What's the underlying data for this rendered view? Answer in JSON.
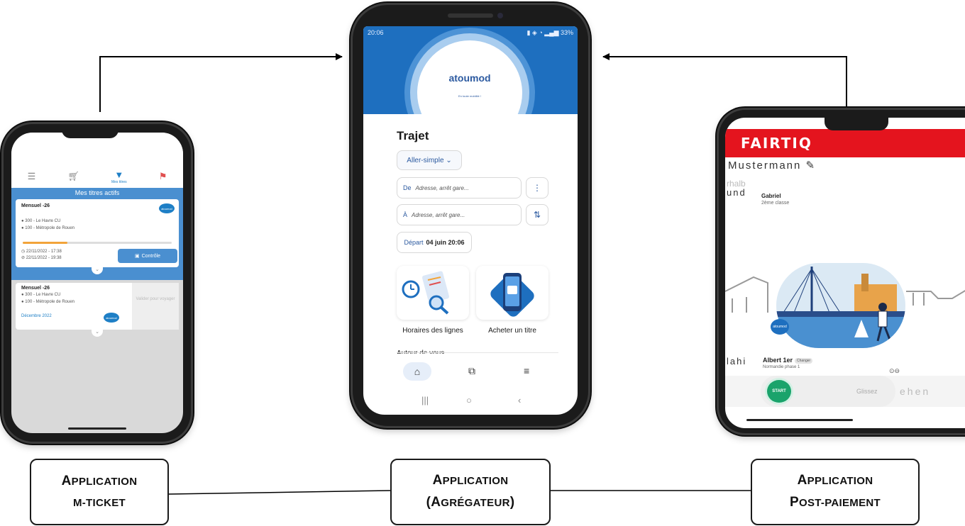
{
  "labels": {
    "mticket": {
      "line1_cap": "A",
      "line1_rest": "PPLICATION",
      "line2": "M-TICKET"
    },
    "aggregator": {
      "line1_cap": "A",
      "line1_rest": "PPLICATION",
      "line2_open": "(A",
      "line2_rest": "GRÉGATEUR",
      "line2_close": ")"
    },
    "postpaid": {
      "line1_cap": "A",
      "line1_rest": "PPLICATION",
      "line2_cap1": "P",
      "line2_rest1": "OST",
      "line2_dash": "-",
      "line2_rest2": "PAIEMENT"
    }
  },
  "left_phone": {
    "nav_active": "Mes titres",
    "band_title": "Mes titres actifs",
    "card1": {
      "title": "Mensuel -26",
      "line_a": "300 - Le Havre CU",
      "line_b": "100 - Métropole de Rouen",
      "progress": 0.3,
      "date_start": "22/11/2022 - 17:38",
      "date_end": "22/11/2022 - 19:38",
      "control_label": "Contrôle"
    },
    "card2": {
      "title": "Mensuel -26",
      "line_a": "300 - Le Havre CU",
      "line_b": "100 - Métropole de Rouen",
      "period": "Décembre 2022",
      "validate_label": "Valider pour voyager"
    }
  },
  "center_phone": {
    "status_time": "20:06",
    "status_right": "33%",
    "logo_text": "atoumod",
    "logo_sub": "En toute mobilité !",
    "title": "Trajet",
    "trip_type": "Aller-simple",
    "from_label": "De",
    "from_placeholder": "Adresse, arrêt gare...",
    "to_label": "À",
    "to_placeholder": "Adresse, arrêt gare...",
    "depart_label": "Départ",
    "depart_value": "04 juin 20:06",
    "tile1_label": "Horaires des lignes",
    "tile2_label": "Acheter un titre",
    "section_peek": "Autour de vous"
  },
  "right_phone": {
    "brand": "FAIRTIQ",
    "user_name": "Mustermann",
    "ghost_top": "rhalb",
    "ghost_left": "und",
    "passenger": "Gabriel",
    "travel_class": "2ème classe",
    "ghost_left2": "lahi",
    "stop": "Albert 1er",
    "change_label": "Changer",
    "stop_sub": "Normandie phase 1",
    "start_label": "START",
    "slide_label": "Glissez",
    "ghost_right": "ehen",
    "badge_text": "atoumod"
  },
  "colors": {
    "atoumod_blue": "#1e6fbf",
    "fairtiq_red": "#e4141e",
    "start_green": "#1aa36b"
  }
}
